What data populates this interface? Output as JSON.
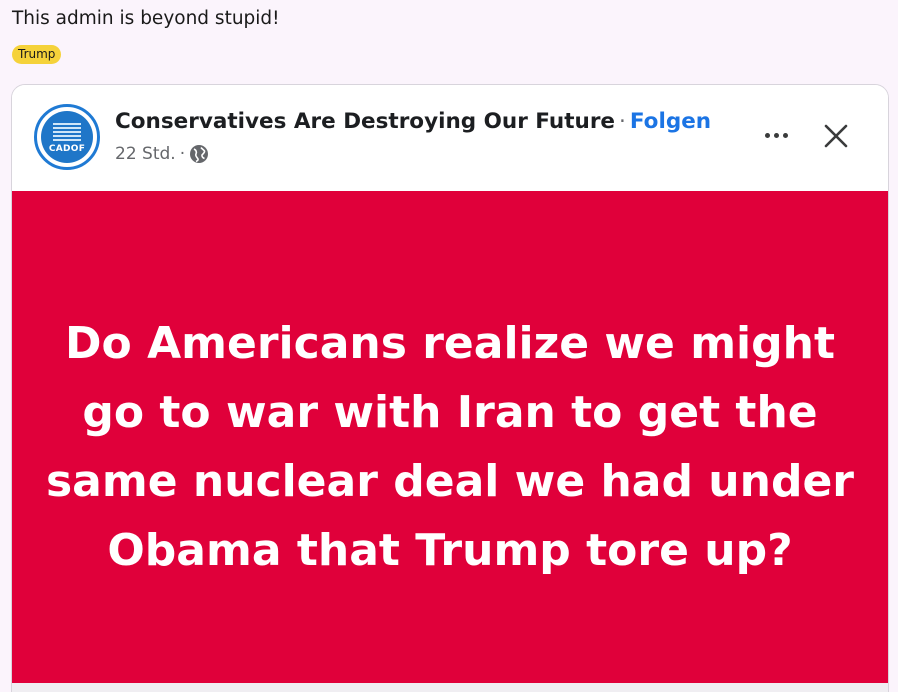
{
  "post": {
    "title": "This admin is beyond stupid!",
    "flair": "Trump"
  },
  "facebook_post": {
    "avatar_label": "CADOF",
    "page_name": "Conservatives Are Destroying Our Future",
    "separator": "·",
    "follow_label": "Folgen",
    "time": "22 Std.",
    "audience_icon": "globe-icon",
    "more_icon": "more-options-icon",
    "close_icon": "close-icon",
    "image_text_lines": [
      "Do Americans realize we might",
      "go to war with Iran to get the",
      "same nuclear deal we had under",
      "Obama that Trump tore up?"
    ],
    "image_bg_color": "#e0003a"
  }
}
